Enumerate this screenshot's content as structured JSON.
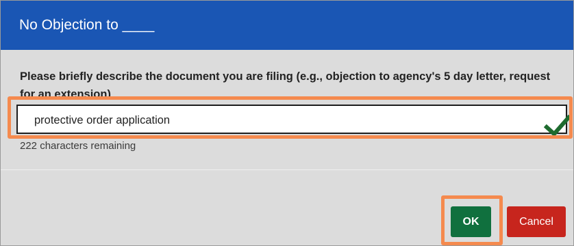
{
  "dialog": {
    "title": "No Objection to ____",
    "prompt": "Please briefly describe the document you are filing (e.g., objection to agency's 5 day letter, request for an extension)",
    "input_value": "protective order application",
    "input_valid_icon": "checkmark-icon",
    "counter_text": "222 characters remaining",
    "ok_label": "OK",
    "cancel_label": "Cancel"
  },
  "colors": {
    "header": "#1a56b4",
    "ok_button": "#10703e",
    "cancel_button": "#c7251d",
    "highlight": "#f58a4e",
    "valid_check": "#1e6b2f",
    "dialog_background": "#dcdcdc"
  }
}
